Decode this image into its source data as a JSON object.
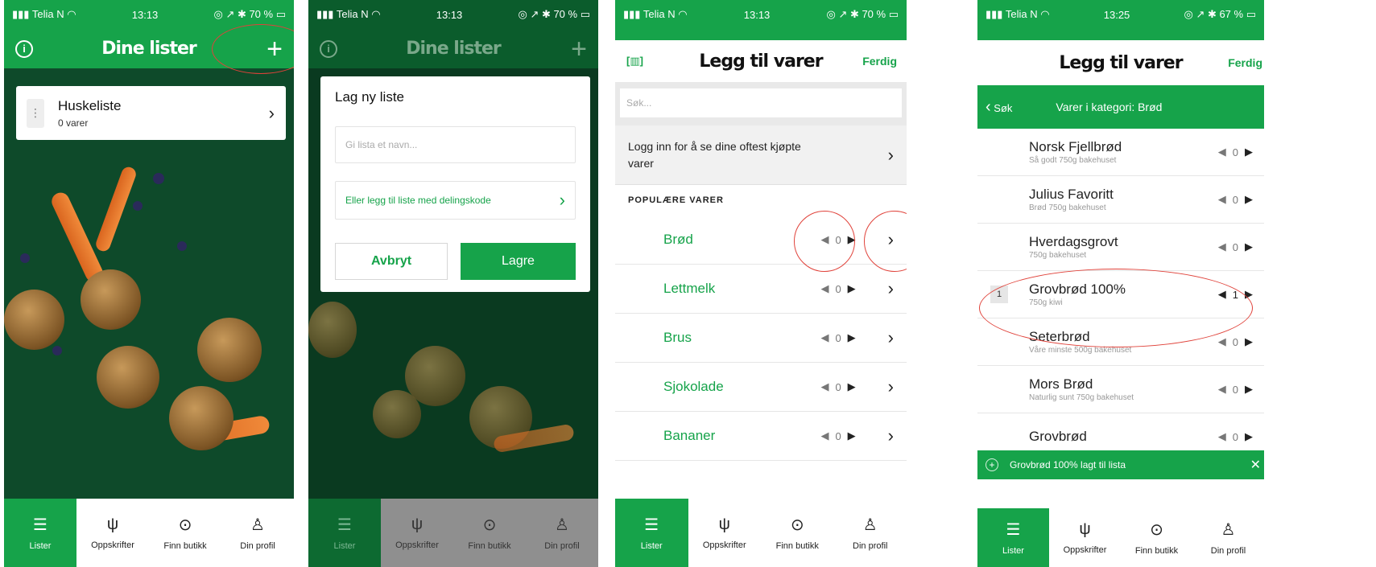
{
  "status": {
    "carrier": "Telia N",
    "time1": "13:13",
    "time4": "13:25",
    "batt1": "70 %",
    "batt4": "67 %"
  },
  "tabs": [
    "Lister",
    "Oppskrifter",
    "Finn butikk",
    "Din profil"
  ],
  "colors": {
    "green": "#16a34a",
    "dark": "#0b5c2c",
    "annotation": "#e0423a"
  },
  "screen1": {
    "title": "Dine lister",
    "list_name": "Huskeliste",
    "list_count": "0 varer"
  },
  "screen2": {
    "title": "Dine lister",
    "dialog_title": "Lag ny liste",
    "name_placeholder": "Gi lista et navn...",
    "share_link": "Eller legg til liste med delingskode",
    "cancel": "Avbryt",
    "save": "Lagre"
  },
  "screen3": {
    "title": "Legg til varer",
    "done": "Ferdig",
    "search_placeholder": "Søk...",
    "login_text": "Logg inn for å se dine oftest kjøpte varer",
    "section": "POPULÆRE VARER",
    "items": [
      {
        "name": "Brød",
        "qty": "0"
      },
      {
        "name": "Lettmelk",
        "qty": "0"
      },
      {
        "name": "Brus",
        "qty": "0"
      },
      {
        "name": "Sjokolade",
        "qty": "0"
      },
      {
        "name": "Bananer",
        "qty": "0"
      }
    ]
  },
  "screen4": {
    "title": "Legg til varer",
    "done": "Ferdig",
    "back": "Søk",
    "category": "Varer i kategori: Brød",
    "toast": "Grovbrød 100% lagt til lista",
    "badge": "1",
    "items": [
      {
        "name": "Norsk Fjellbrød",
        "sub": "Så godt 750g bakehuset",
        "qty": "0"
      },
      {
        "name": "Julius Favoritt",
        "sub": "Brød 750g bakehuset",
        "qty": "0"
      },
      {
        "name": "Hverdagsgrovt",
        "sub": "750g bakehuset",
        "qty": "0"
      },
      {
        "name": "Grovbrød 100%",
        "sub": "750g kiwi",
        "qty": "1"
      },
      {
        "name": "Seterbrød",
        "sub": "Våre minste 500g bakehuset",
        "qty": "0"
      },
      {
        "name": "Mors Brød",
        "sub": "Naturlig sunt 750g bakehuset",
        "qty": "0"
      },
      {
        "name": "Grovbrød",
        "sub": "",
        "qty": "0"
      }
    ]
  }
}
